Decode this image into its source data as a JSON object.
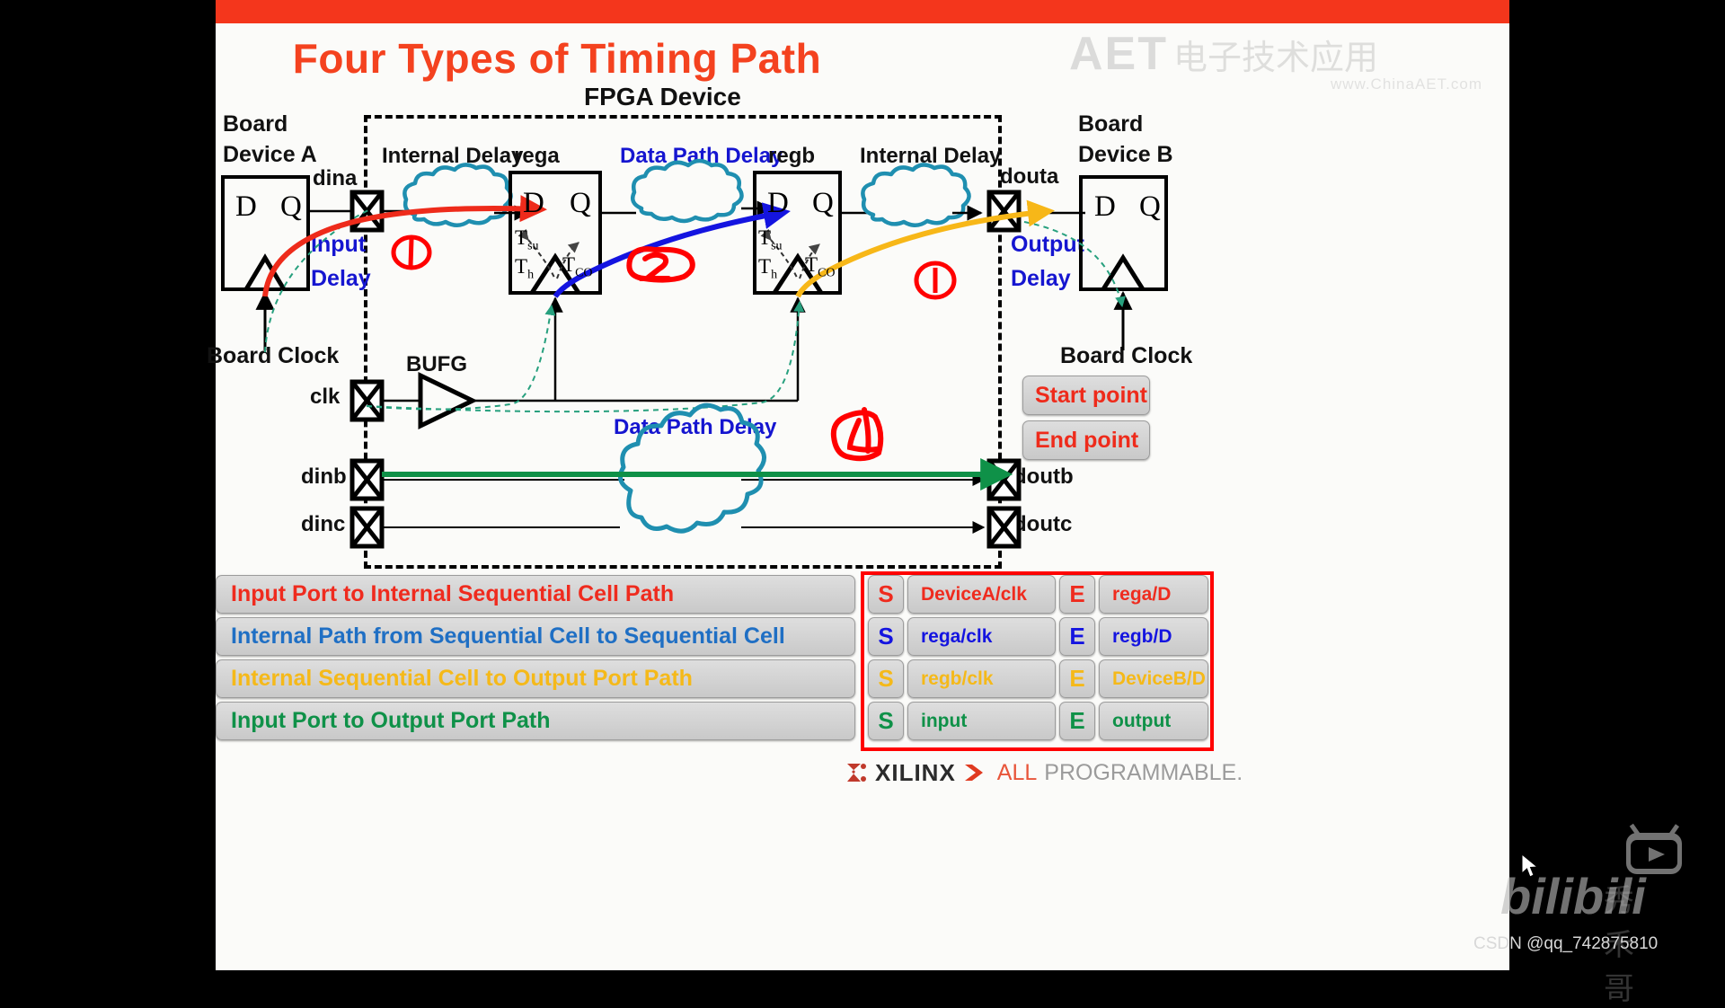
{
  "slide": {
    "title": "Four Types of Timing Path",
    "fpga_label": "FPGA Device",
    "watermark": {
      "aet_logo": "AET",
      "aet_cn": "电子技术应用",
      "aet_url": "www.ChinaAET.com",
      "csdn": "CSDN @qq_742875810",
      "bilibili": "bilibili",
      "cn_nick": "秀禾哥"
    },
    "footer": {
      "brand": "XILINX",
      "tag_all": "ALL",
      "tag_programmable": "PROGRAMMABLE."
    }
  },
  "diagram": {
    "left_board": {
      "line1": "Board",
      "line2": "Device A"
    },
    "right_board": {
      "line1": "Board",
      "line2": "Device B"
    },
    "ff_left": {
      "d": "D",
      "q": "Q"
    },
    "ff_rega": {
      "d": "D",
      "q": "Q",
      "name": "rega",
      "tsu": "T",
      "tsu_sub": "su",
      "th": "T",
      "th_sub": "h",
      "tco": "T",
      "tco_sub": "CO"
    },
    "ff_regb": {
      "d": "D",
      "q": "Q",
      "name": "regb",
      "tsu": "T",
      "tsu_sub": "su",
      "th": "T",
      "th_sub": "h",
      "tco": "T",
      "tco_sub": "CO"
    },
    "ff_right": {
      "d": "D",
      "q": "Q"
    },
    "internal_delay_left": "Internal Delay",
    "internal_delay_right": "Internal Delay",
    "data_path_delay_top": "Data Path Delay",
    "data_path_delay_bottom": "Data Path Delay",
    "input_delay_l1": "Input",
    "input_delay_l2": "Delay",
    "output_delay_l1": "Output",
    "output_delay_l2": "Delay",
    "board_clock_left": "Board Clock",
    "board_clock_right": "Board Clock",
    "bufg": "BUFG",
    "ports": {
      "dina": "dina",
      "clk": "clk",
      "dinb": "dinb",
      "dinc": "dinc",
      "douta": "douta",
      "doutb": "doutb",
      "doutc": "doutc"
    },
    "annotations": [
      "1",
      "2",
      "1",
      "4"
    ],
    "annot_marks": {
      "m1": "1",
      "m2": "2",
      "m3": "1",
      "m4": "4"
    }
  },
  "keys": {
    "start_point": "Start point",
    "end_point": "End point"
  },
  "legend": {
    "rows": [
      {
        "path": "Input Port to Internal Sequential Cell Path",
        "color": "#ef2b1e",
        "s_key": "S",
        "start": "DeviceA/clk",
        "e_key": "E",
        "end": "rega/D"
      },
      {
        "path": "Internal Path from Sequential Cell to Sequential Cell",
        "color": "#1f6fc4",
        "s_key": "S",
        "start": "rega/clk",
        "e_key": "E",
        "end": "regb/D",
        "chip_color": "#1414e0"
      },
      {
        "path": "Internal Sequential Cell to Output Port Path",
        "color": "#f5b919",
        "s_key": "S",
        "start": "regb/clk",
        "e_key": "E",
        "end": "DeviceB/D",
        "chip_color": "#f5b919"
      },
      {
        "path": "Input Port to Output Port Path",
        "color": "#0f9148",
        "s_key": "S",
        "start": "input",
        "e_key": "E",
        "end": "output",
        "chip_color": "#0f9148"
      }
    ]
  },
  "colors": {
    "title": "#f4421f",
    "topbar": "#f4361c",
    "path1": "#ee2b1b",
    "path2": "#1414e0",
    "path3": "#f7b718",
    "path4": "#0f9148",
    "cloud": "#1f8fb0",
    "clock_dash": "#27a07e",
    "annotation": "#ff0000",
    "legend_frame": "#ff0000"
  }
}
